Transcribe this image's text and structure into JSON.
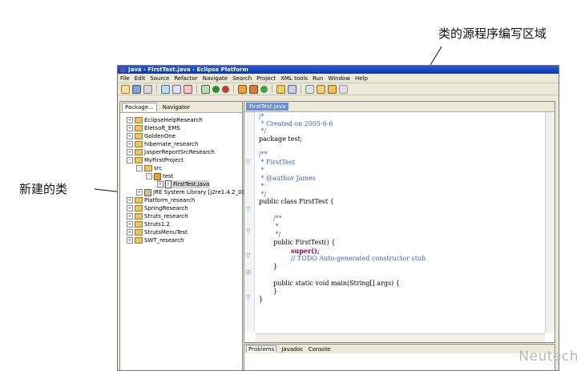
{
  "annotations": {
    "editor_label": "类的源程序编写区域",
    "new_class_label": "新建的类"
  },
  "window": {
    "title": "Java - FirstTest.java - Eclipse Platform",
    "menu": [
      "File",
      "Edit",
      "Source",
      "Refactor",
      "Navigate",
      "Search",
      "Project",
      "XML tools",
      "Run",
      "Window",
      "Help"
    ]
  },
  "left_panel": {
    "tabs": [
      "Package...",
      "Navigator"
    ],
    "tree": [
      "EclipseHelpResearch",
      "Eletsoft_EMS",
      "GoldenOne",
      "hibernate_research",
      "JasperReportSrcResearch",
      "MyFirstProject",
      "src",
      "test",
      "FirstTest.java",
      "JRE System Library [j2re1.4.2_03]",
      "Platform_research",
      "SpringResearch",
      "Struts_research",
      "Struts1.2",
      "StrutsMenuTest",
      "SWT_research"
    ]
  },
  "editor": {
    "tab": "FirstTest.java",
    "lines": [
      "/*",
      " * Created on 2005-6-6",
      " */",
      "package test;",
      "/**",
      " * FirstTest",
      " *",
      " * @author James",
      " *",
      " */",
      "public class FirstTest {",
      "/**",
      " *",
      " */",
      "public FirstTest() {",
      "super();",
      "// TODO Auto-generated constructor stub",
      "}",
      "public static void main(String[] args) {",
      "}",
      "}"
    ]
  },
  "bottom_panel": {
    "tabs": [
      "Problems",
      "Javadoc",
      "Console"
    ]
  },
  "watermark": "Neutech"
}
